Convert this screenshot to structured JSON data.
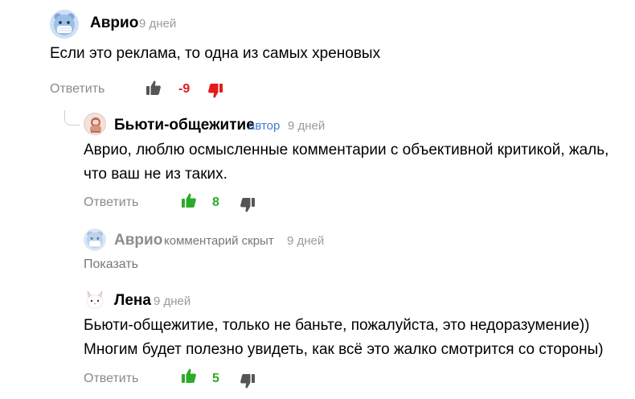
{
  "colors": {
    "positive": "#2eaa2a",
    "negative": "#e31b1b",
    "neutral_icon": "#555555",
    "author_tag": "#3f7bd1",
    "muted": "#9a9a9a"
  },
  "comments": [
    {
      "author": "Аврио",
      "time": "9 дней",
      "text_lines": [
        "Если это реклама, то одна из самых хреновых"
      ],
      "reply_label": "Ответить",
      "score": "-9",
      "score_state": "negative",
      "avatar_icon": "masked-bear-avatar"
    },
    {
      "author": "Бьюти-общежитие",
      "role": "автор",
      "time": "9 дней",
      "text_lines": [
        "Аврио, люблю осмысленные комментарии с объективной критикой, жаль,",
        "что ваш не из таких."
      ],
      "reply_label": "Ответить",
      "score": "8",
      "score_state": "positive",
      "avatar_icon": "channel-logo-avatar"
    },
    {
      "author": "Аврио",
      "hidden_note": "комментарий скрыт",
      "time": "9 дней",
      "show_label": "Показать",
      "avatar_icon": "masked-bear-avatar"
    },
    {
      "author": "Лена",
      "time": "9 дней",
      "text_lines": [
        "Бьюти-общежитие, только не баньте, пожалуйста, это недоразумение))",
        "Многим будет полезно увидеть, как всё это жалко смотрится со стороны)"
      ],
      "reply_label": "Ответить",
      "score": "5",
      "score_state": "positive",
      "avatar_icon": "white-cat-avatar"
    }
  ]
}
